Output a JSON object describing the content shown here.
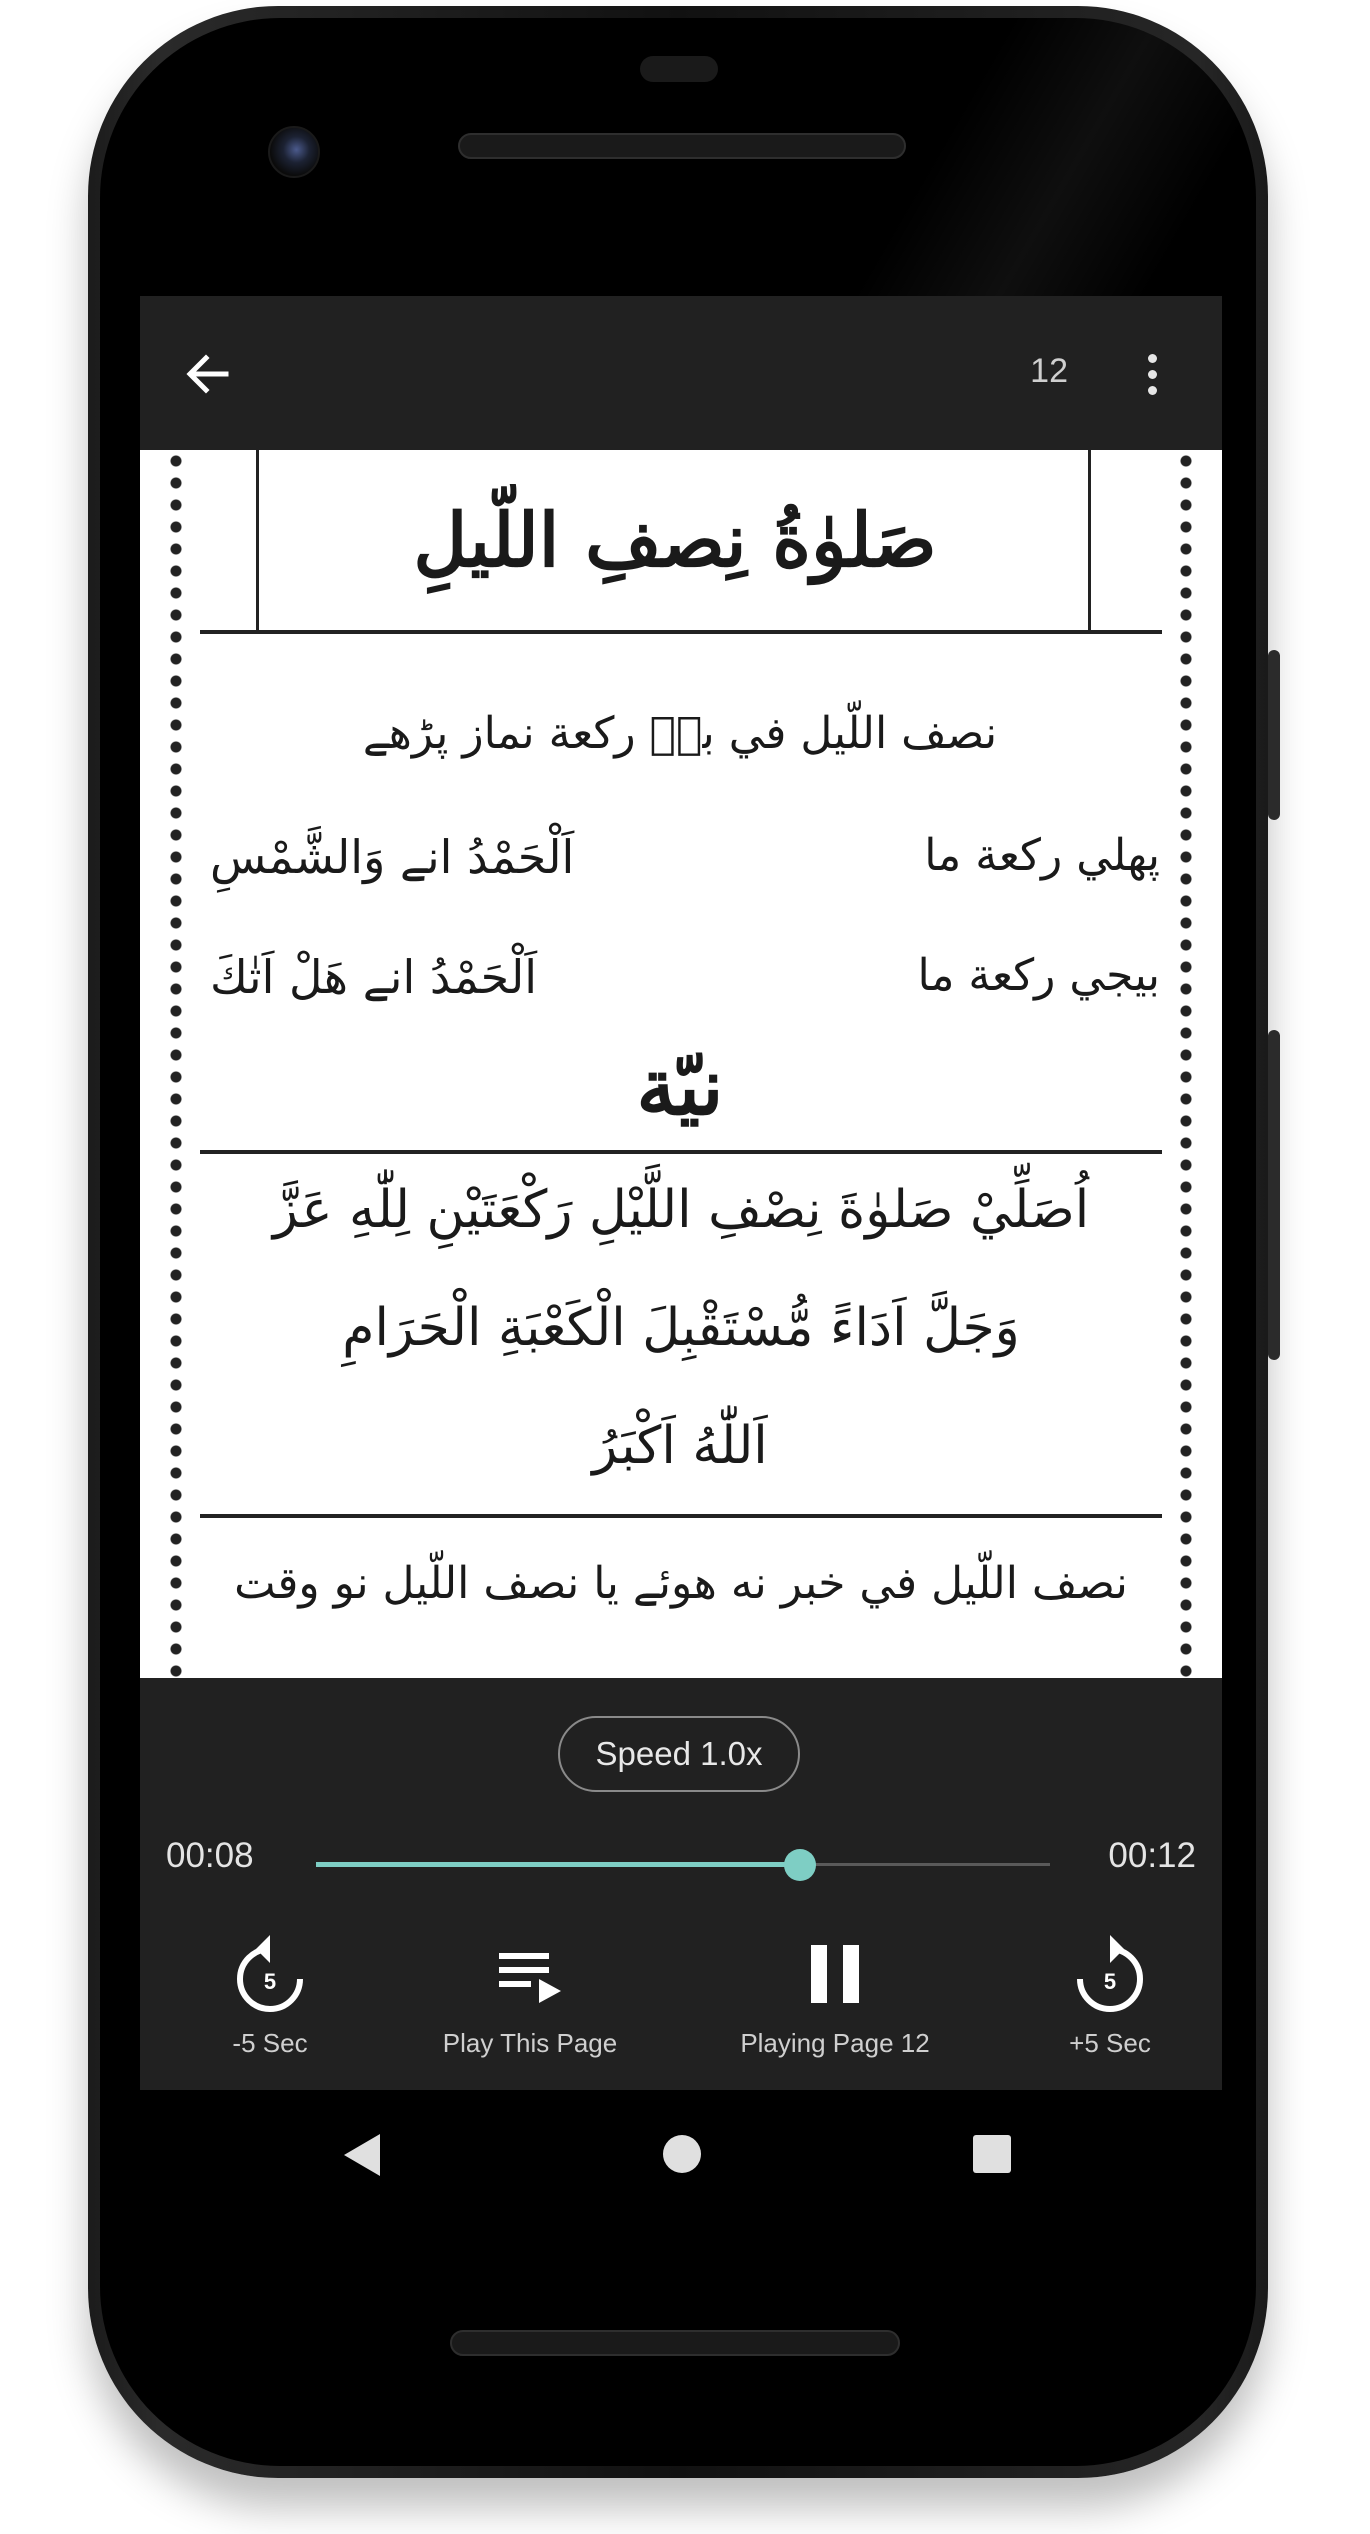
{
  "appbar": {
    "back_icon": "arrow-left-icon",
    "page_number": "12",
    "menu_icon": "more-vert-icon"
  },
  "page_image": {
    "title": "صَلوٰةُ نِصفِ اللّيلِ",
    "line1": "نصف اللّيل في بےؑ رکعة نماز پڑھے",
    "row1_right": "پهلي رکعة ما",
    "row1_left": "اَلْحَمْدُ انے وَالشَّمْسِ",
    "row2_right": "بيجي رکعة ما",
    "row2_left": "اَلْحَمْدُ انے هَلْ اَتٰكَ",
    "niyyat_heading": "نيّة",
    "niyyat_line1": "اُصَلِّيْ صَلوٰةَ نِصْفِ اللَّيْلِ رَكْعَتَيْنِ لِلّٰهِ عَزَّ",
    "niyyat_line2": "وَجَلَّ اَدَاءً مُّسْتَقْبِلَ الْكَعْبَةِ الْحَرَامِ",
    "niyyat_line3": "اَللّٰهُ اَكْبَرُ",
    "footer_line": "نصف اللّيل في خبر نه هوئے يا نصف اللّيل نو وقت"
  },
  "player": {
    "speed_label": "Speed 1.0x",
    "elapsed": "00:08",
    "duration": "00:12",
    "progress_fraction": 0.66,
    "accent_color": "#7ecec4",
    "controls": [
      {
        "icon": "replay-5-icon",
        "label": "-5 Sec"
      },
      {
        "icon": "playlist-play-icon",
        "label": "Play This Page"
      },
      {
        "icon": "pause-icon",
        "label": "Playing Page 12"
      },
      {
        "icon": "forward-5-icon",
        "label": "+5 Sec"
      }
    ],
    "replay_digit": "5",
    "forward_digit": "5"
  },
  "navbar": {
    "back_icon": "nav-back-icon",
    "home_icon": "nav-home-icon",
    "recents_icon": "nav-recents-icon"
  }
}
